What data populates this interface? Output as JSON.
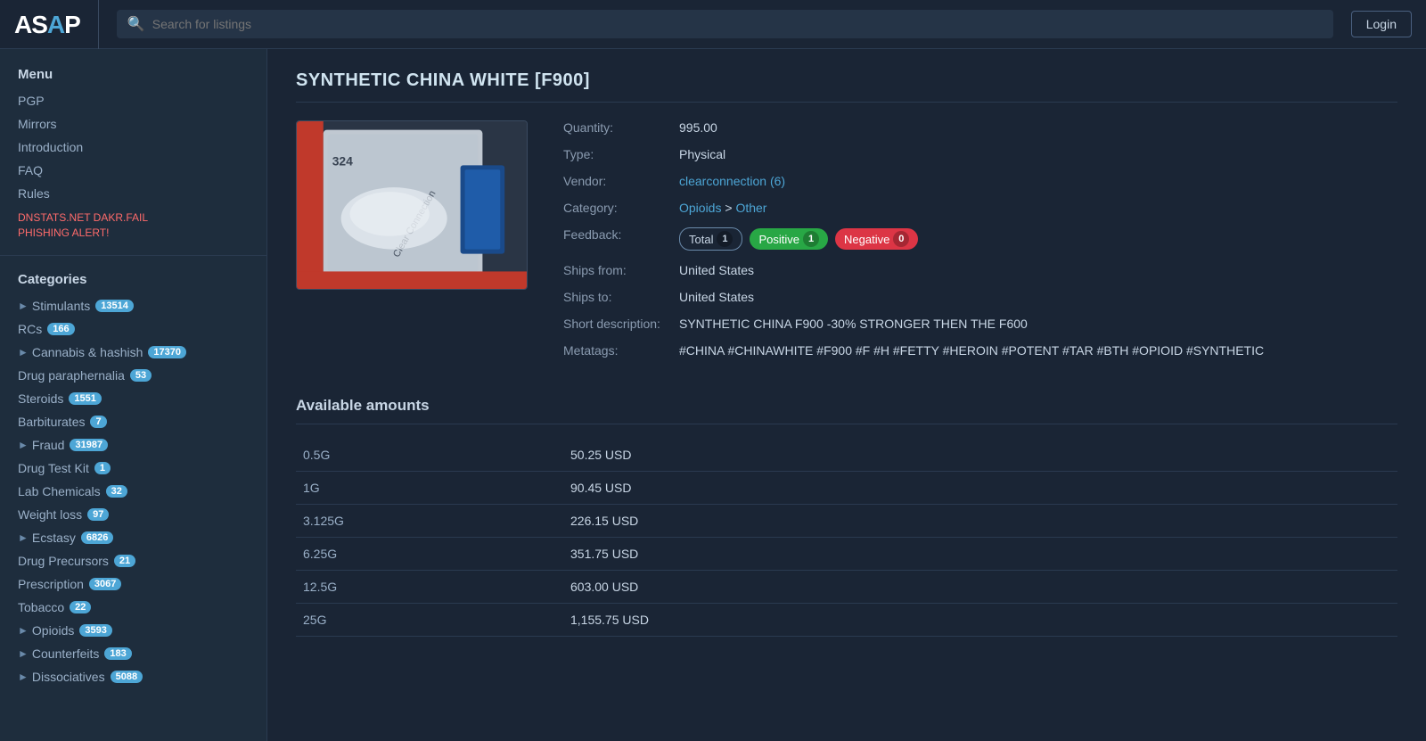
{
  "header": {
    "logo_text": "ASAP",
    "search_placeholder": "Search for listings",
    "login_label": "Login"
  },
  "sidebar": {
    "menu_header": "Menu",
    "menu_items": [
      {
        "label": "PGP"
      },
      {
        "label": "Mirrors"
      },
      {
        "label": "Introduction"
      },
      {
        "label": "FAQ"
      },
      {
        "label": "Rules"
      },
      {
        "label": "DNSTATS.NET DAKR.FAIL\nPHISHING ALERT!"
      }
    ],
    "categories_header": "Categories",
    "categories": [
      {
        "label": "Stimulants",
        "badge": "13514",
        "has_arrow": true
      },
      {
        "label": "RCs",
        "badge": "166",
        "has_arrow": false
      },
      {
        "label": "Cannabis & hashish",
        "badge": "17370",
        "has_arrow": true
      },
      {
        "label": "Drug paraphernalia",
        "badge": "53",
        "has_arrow": false
      },
      {
        "label": "Steroids",
        "badge": "1551",
        "has_arrow": false
      },
      {
        "label": "Barbiturates",
        "badge": "7",
        "has_arrow": false
      },
      {
        "label": "Fraud",
        "badge": "31987",
        "has_arrow": true
      },
      {
        "label": "Drug Test Kit",
        "badge": "1",
        "has_arrow": false
      },
      {
        "label": "Lab Chemicals",
        "badge": "32",
        "has_arrow": false
      },
      {
        "label": "Weight loss",
        "badge": "97",
        "has_arrow": false
      },
      {
        "label": "Ecstasy",
        "badge": "6826",
        "has_arrow": true
      },
      {
        "label": "Drug Precursors",
        "badge": "21",
        "has_arrow": false
      },
      {
        "label": "Prescription",
        "badge": "3067",
        "has_arrow": false
      },
      {
        "label": "Tobacco",
        "badge": "22",
        "has_arrow": false
      },
      {
        "label": "Opioids",
        "badge": "3593",
        "has_arrow": true
      },
      {
        "label": "Counterfeits",
        "badge": "183",
        "has_arrow": true
      },
      {
        "label": "Dissociatives",
        "badge": "5088",
        "has_arrow": true
      }
    ]
  },
  "product": {
    "title": "SYNTHETIC CHINA WHITE [F900]",
    "quantity": "995.00",
    "type": "Physical",
    "vendor": "clearconnection (6)",
    "category_main": "Opioids",
    "category_sub": "Other",
    "feedback": {
      "total": 1,
      "positive": 1,
      "negative": 0,
      "total_label": "Total",
      "positive_label": "Positive",
      "negative_label": "Negative"
    },
    "ships_from": "United States",
    "ships_to": "United States",
    "short_description": "SYNTHETIC CHINA F900 -30% STRONGER THEN THE F600",
    "metatags": "#CHINA #CHINAWHITE #F900 #F #H #FETTY #HEROIN #POTENT #TAR #BTH #OPIOID #SYNTHETIC"
  },
  "amounts": {
    "title": "Available amounts",
    "rows": [
      {
        "size": "0.5G",
        "price": "50.25 USD"
      },
      {
        "size": "1G",
        "price": "90.45 USD"
      },
      {
        "size": "3.125G",
        "price": "226.15 USD"
      },
      {
        "size": "6.25G",
        "price": "351.75 USD"
      },
      {
        "size": "12.5G",
        "price": "603.00 USD"
      },
      {
        "size": "25G",
        "price": "1,155.75 USD"
      }
    ]
  },
  "labels": {
    "quantity": "Quantity:",
    "type": "Type:",
    "vendor": "Vendor:",
    "category": "Category:",
    "feedback": "Feedback:",
    "ships_from": "Ships from:",
    "ships_to": "Ships to:",
    "short_description": "Short description:",
    "metatags": "Metatags:",
    "category_arrow": ">"
  }
}
